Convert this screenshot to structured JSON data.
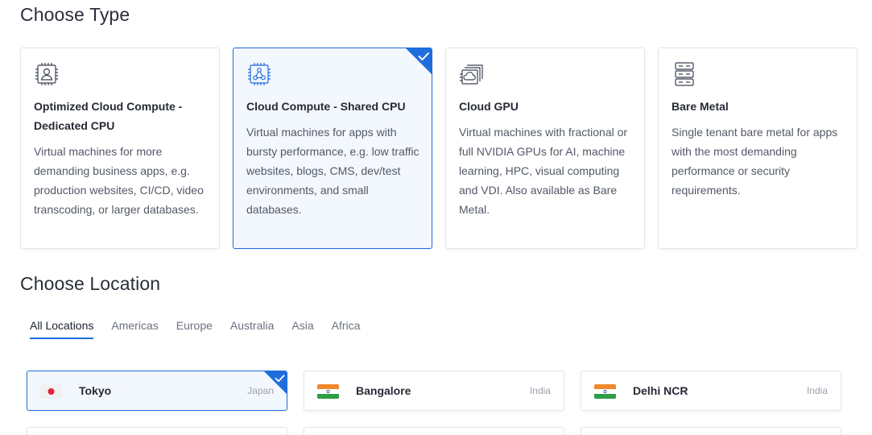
{
  "type_section": {
    "title": "Choose Type",
    "cards": [
      {
        "icon": "cpu-user-icon",
        "name": "Optimized Cloud Compute - Dedicated CPU",
        "description": "Virtual machines for more demanding business apps, e.g. production websites, CI/CD, video transcoding, or larger databases.",
        "selected": false
      },
      {
        "icon": "cpu-network-icon",
        "name": "Cloud Compute - Shared CPU",
        "description": "Virtual machines for apps with bursty performance, e.g. low traffic websites, blogs, CMS, dev/test environments, and small databases.",
        "selected": true
      },
      {
        "icon": "gpu-icon",
        "name": "Cloud GPU",
        "description": "Virtual machines with fractional or full NVIDIA GPUs for AI, machine learning, HPC, visual computing and VDI. Also available as Bare Metal.",
        "selected": false
      },
      {
        "icon": "server-rack-icon",
        "name": "Bare Metal",
        "description": "Single tenant bare metal for apps with the most demanding performance or security requirements.",
        "selected": false
      }
    ]
  },
  "location_section": {
    "title": "Choose Location",
    "tabs": [
      "All Locations",
      "Americas",
      "Europe",
      "Australia",
      "Asia",
      "Africa"
    ],
    "active_tab": "All Locations",
    "locations": [
      {
        "city": "Tokyo",
        "country": "Japan",
        "flag": "japan-flag-icon",
        "selected": true
      },
      {
        "city": "Bangalore",
        "country": "India",
        "flag": "india-flag-icon",
        "selected": false
      },
      {
        "city": "Delhi NCR",
        "country": "India",
        "flag": "india-flag-icon",
        "selected": false
      }
    ]
  },
  "colors": {
    "accent": "#1e6ddc",
    "selected_bg": "#f3f7fe",
    "border": "#e3e6ec",
    "text_dark": "#262a35",
    "text_muted": "#525866"
  }
}
